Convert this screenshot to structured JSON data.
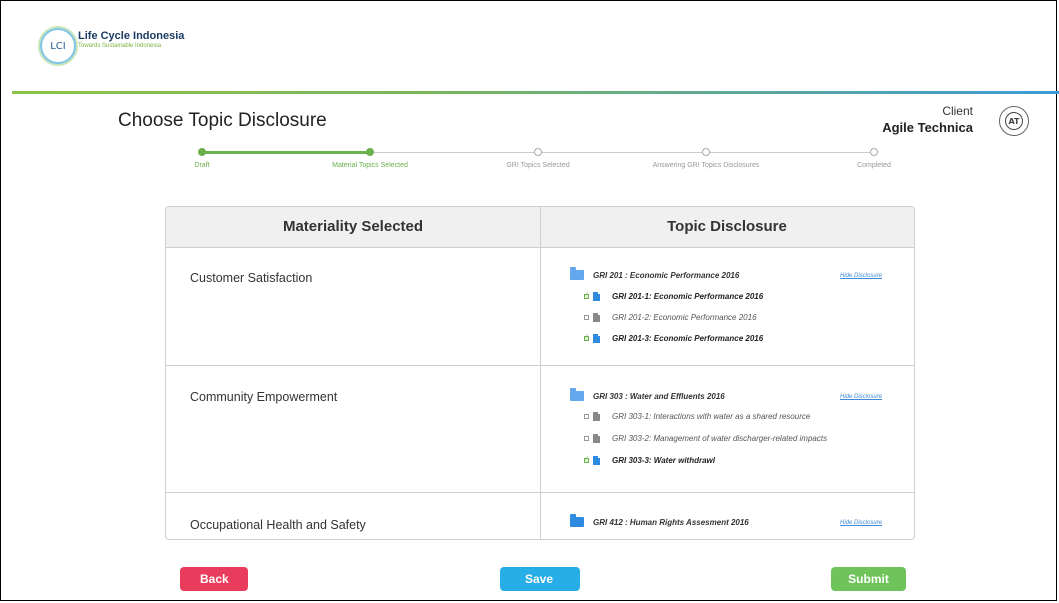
{
  "brand": {
    "logo_text": "LCI",
    "name": "Life Cycle Indonesia",
    "tagline": "Towards Sustainable Indonesia"
  },
  "page": {
    "title": "Choose Topic Disclosure"
  },
  "client": {
    "label": "Client",
    "name": "Agile Technica",
    "logo_text": "AT"
  },
  "stepper": {
    "steps": [
      {
        "label": "Draft",
        "status": "done"
      },
      {
        "label": "Material Topics Selected",
        "status": "done"
      },
      {
        "label": "GRI Topics Selected",
        "status": "pending"
      },
      {
        "label": "Answering GRI Topics Disclosures",
        "status": "pending"
      },
      {
        "label": "Completed",
        "status": "pending"
      }
    ]
  },
  "table": {
    "headers": {
      "materiality": "Materiality Selected",
      "disclosure": "Topic Disclosure"
    },
    "hide_label": "Hide Disclosure",
    "rows": [
      {
        "material": "Customer Satisfaction",
        "gri": "GRI 201 : Economic Performance 2016",
        "items": [
          {
            "text": "GRI 201-1: Economic Performance 2016",
            "checked": true
          },
          {
            "text": "GRI 201-2: Economic Performance 2016",
            "checked": false
          },
          {
            "text": "GRI 201-3: Economic Performance 2016",
            "checked": true
          }
        ]
      },
      {
        "material": "Community Empowerment",
        "gri": "GRI 303 : Water and Effluents 2016",
        "items": [
          {
            "text": "GRI 303-1: Interactions with water as a shared resource",
            "checked": false
          },
          {
            "text": "GRI 303-2: Management of water discharger-related impacts",
            "checked": false
          },
          {
            "text": "GRI 303-3: Water withdrawl",
            "checked": true
          }
        ]
      },
      {
        "material": "Occupational Health and Safety",
        "gri": "GRI 412 : Human Rights Assesment 2016",
        "items": []
      }
    ]
  },
  "buttons": {
    "back": "Back",
    "save": "Save",
    "submit": "Submit"
  },
  "colors": {
    "accent_green": "#6ab04c",
    "accent_blue": "#2f8be0",
    "back": "#e93b5b",
    "save": "#28aee6",
    "submit": "#6ec45a"
  }
}
